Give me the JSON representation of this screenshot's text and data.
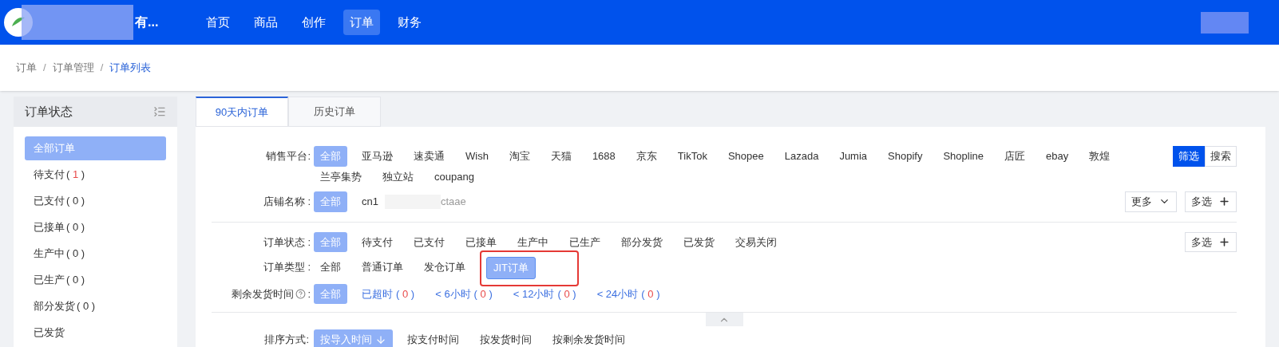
{
  "header": {
    "brand": "有...",
    "nav": [
      {
        "label": "首页",
        "selected": false
      },
      {
        "label": "商品",
        "selected": false
      },
      {
        "label": "创作",
        "selected": false
      },
      {
        "label": "订单",
        "selected": true
      },
      {
        "label": "财务",
        "selected": false
      }
    ]
  },
  "breadcrumb_separator": "/",
  "count_brackets": [
    "(",
    ")"
  ],
  "breadcrumb": [
    {
      "label": "订单",
      "current": false
    },
    {
      "label": "订单管理",
      "current": false
    },
    {
      "label": "订单列表",
      "current": true
    }
  ],
  "sidebar": {
    "title": "订单状态",
    "items": [
      {
        "label": "全部订单",
        "selected": true
      },
      {
        "label": "待支付",
        "count": "1",
        "alert": true,
        "selected": false
      },
      {
        "label": "已支付",
        "count": "0",
        "alert": false,
        "selected": false
      },
      {
        "label": "已接单",
        "count": "0",
        "alert": false,
        "selected": false
      },
      {
        "label": "生产中",
        "count": "0",
        "alert": false,
        "selected": false
      },
      {
        "label": "已生产",
        "count": "0",
        "alert": false,
        "selected": false
      },
      {
        "label": "部分发货",
        "count": "0",
        "alert": false,
        "selected": false
      },
      {
        "label": "已发货",
        "selected": false
      }
    ]
  },
  "tabs": [
    {
      "label": "90天内订单",
      "selected": true
    },
    {
      "label": "历史订单",
      "selected": false
    }
  ],
  "view_toggle": [
    {
      "label": "筛选",
      "selected": true
    },
    {
      "label": "搜索",
      "selected": false
    }
  ],
  "filters": [
    {
      "label": "销售平台:",
      "options": [
        {
          "label": "全部",
          "selected": true
        },
        {
          "label": "亚马逊",
          "selected": false
        },
        {
          "label": "速卖通",
          "selected": false
        },
        {
          "label": "Wish",
          "selected": false
        },
        {
          "label": "淘宝",
          "selected": false
        },
        {
          "label": "天猫",
          "selected": false
        },
        {
          "label": "1688",
          "selected": false
        },
        {
          "label": "京东",
          "selected": false
        },
        {
          "label": "TikTok",
          "selected": false
        },
        {
          "label": "Shopee",
          "selected": false
        },
        {
          "label": "Lazada",
          "selected": false
        },
        {
          "label": "Jumia",
          "selected": false
        },
        {
          "label": "Shopify",
          "selected": false
        },
        {
          "label": "Shopline",
          "selected": false
        },
        {
          "label": "店匠",
          "selected": false
        },
        {
          "label": "ebay",
          "selected": false
        },
        {
          "label": "敦煌",
          "selected": false
        },
        {
          "label": "兰亭集势",
          "selected": false
        },
        {
          "label": "独立站",
          "selected": false
        },
        {
          "label": "coupang",
          "selected": false
        }
      ]
    },
    {
      "label": "店铺名称 :",
      "options": [
        {
          "label": "全部",
          "selected": true
        },
        {
          "label": "cn1",
          "suffix": "ctaae",
          "redacted": true,
          "selected": false
        }
      ],
      "buttons": [
        {
          "kind": "dropdown",
          "label": "更多"
        },
        {
          "kind": "add",
          "label": "多选"
        }
      ]
    },
    {
      "label": "订单状态 :",
      "divider": true,
      "options": [
        {
          "label": "全部",
          "selected": true
        },
        {
          "label": "待支付",
          "selected": false
        },
        {
          "label": "已支付",
          "selected": false
        },
        {
          "label": "已接单",
          "selected": false
        },
        {
          "label": "生产中",
          "selected": false
        },
        {
          "label": "已生产",
          "selected": false
        },
        {
          "label": "部分发货",
          "selected": false
        },
        {
          "label": "已发货",
          "selected": false
        },
        {
          "label": "交易关闭",
          "selected": false
        }
      ],
      "buttons": [
        {
          "kind": "add",
          "label": "多选"
        }
      ]
    },
    {
      "label": "订单类型 :",
      "options": [
        {
          "label": "全部",
          "selected": false
        },
        {
          "label": "普通订单",
          "selected": false
        },
        {
          "label": "发仓订单",
          "selected": false
        },
        {
          "label": "JIT订单",
          "selected": true,
          "highlighted": true
        }
      ]
    },
    {
      "label": "剩余发货时间",
      "help": true,
      "colon": ":",
      "options": [
        {
          "label": "全部",
          "selected": true
        },
        {
          "label": "已超时",
          "count": "0",
          "link": true,
          "selected": false
        },
        {
          "label": "< 6小时",
          "count": "0",
          "link": true,
          "selected": false
        },
        {
          "label": "< 12小时",
          "count": "0",
          "link": true,
          "selected": false
        },
        {
          "label": "< 24小时",
          "count": "0",
          "link": true,
          "selected": false
        }
      ]
    }
  ],
  "sort": {
    "label": "排序方式:",
    "options": [
      {
        "label": "按导入时间",
        "arrow": true,
        "selected": true
      },
      {
        "label": "按支付时间",
        "selected": false
      },
      {
        "label": "按发货时间",
        "selected": false
      },
      {
        "label": "按剩余发货时间",
        "selected": false
      }
    ]
  }
}
